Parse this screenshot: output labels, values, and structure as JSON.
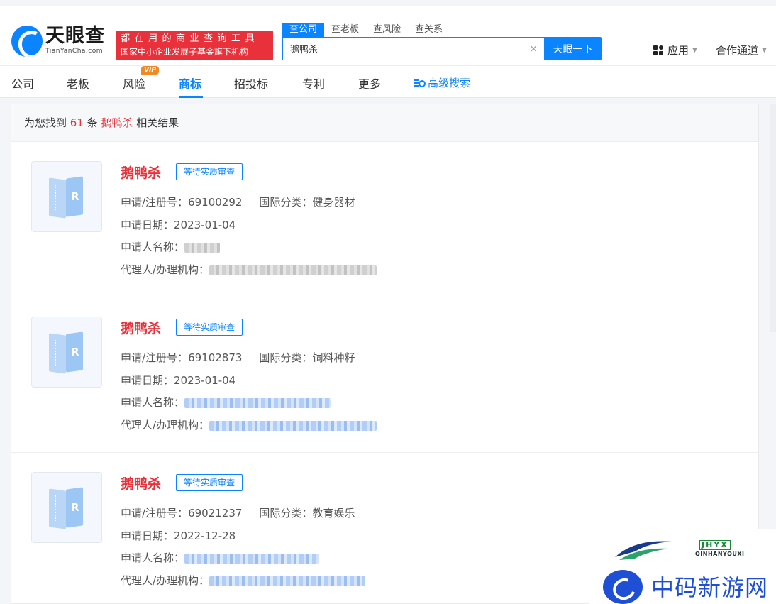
{
  "header": {
    "logo_title": "天眼查",
    "logo_sub": "TianYanCha.com",
    "promo_line1": "都在用的商业查询工具",
    "promo_line2": "国家中小企业发展子基金旗下机构",
    "search_tabs": [
      "查公司",
      "查老板",
      "查风险",
      "查关系"
    ],
    "search_value": "鹅鸭杀",
    "search_button": "天眼一下",
    "apps_label": "应用",
    "coop_label": "合作通道"
  },
  "nav": {
    "items": [
      "公司",
      "老板",
      "风险",
      "商标",
      "招投标",
      "专利",
      "更多"
    ],
    "active": "商标",
    "vip_badge": "VIP",
    "advanced_search": "高级搜索"
  },
  "results": {
    "prefix": "为您找到",
    "count": "61",
    "unit": "条",
    "keyword": "鹅鸭杀",
    "suffix": "相关结果",
    "items": [
      {
        "name": "鹅鸭杀",
        "status": "等待实质审查",
        "reg_label": "申请/注册号：",
        "reg_no": "69100292",
        "class_label": "国际分类：",
        "class": "健身器材",
        "date_label": "申请日期：",
        "date": "2023-01-04",
        "applicant_label": "申请人名称：",
        "agent_label": "代理人/办理机构："
      },
      {
        "name": "鹅鸭杀",
        "status": "等待实质审查",
        "reg_label": "申请/注册号：",
        "reg_no": "69102873",
        "class_label": "国际分类：",
        "class": "饲料种籽",
        "date_label": "申请日期：",
        "date": "2023-01-04",
        "applicant_label": "申请人名称：",
        "agent_label": "代理人/办理机构："
      },
      {
        "name": "鹅鸭杀",
        "status": "等待实质审查",
        "reg_label": "申请/注册号：",
        "reg_no": "69021237",
        "class_label": "国际分类：",
        "class": "教育娱乐",
        "date_label": "申请日期：",
        "date": "2022-12-28",
        "applicant_label": "申请人名称：",
        "agent_label": "代理人/办理机构："
      }
    ]
  },
  "watermark": {
    "badge": "JHYX",
    "brand": "QINHANYOUXI",
    "text": "中码新游网"
  },
  "colors": {
    "accent": "#0a84ff",
    "highlight": "#e8313a",
    "vip": "#f08a24"
  }
}
